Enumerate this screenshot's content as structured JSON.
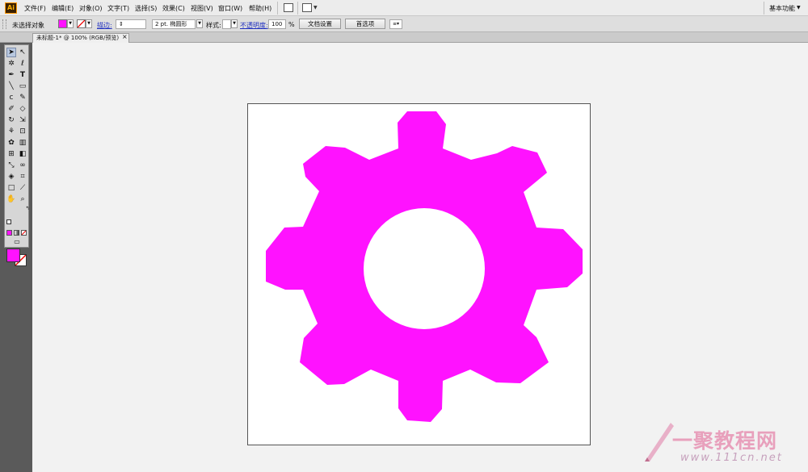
{
  "app": {
    "logo": "Ai",
    "menus": [
      "文件(F)",
      "编辑(E)",
      "对象(O)",
      "文字(T)",
      "选择(S)",
      "效果(C)",
      "视图(V)",
      "窗口(W)",
      "帮助(H)"
    ],
    "workspace_label": "基本功能"
  },
  "control_bar": {
    "selection_status": "未选择对象",
    "fill_color": "#ff12ff",
    "stroke_label": "描边:",
    "stroke_weight": "",
    "brush_value": "2 pt. 椭圆形",
    "style_label": "样式:",
    "opacity_label": "不透明度:",
    "opacity_value": "100",
    "opacity_unit": "%",
    "doc_setup_button": "文档设置",
    "preferences_button": "首选项"
  },
  "document": {
    "tab_title": "未标题-1* @ 100% (RGB/预览)",
    "tab_close": "×"
  },
  "tools": {
    "fill_color": "#ff12ff",
    "stroke_color": "none"
  },
  "artwork": {
    "shape": "gear-icon",
    "color": "#ff12ff",
    "background": "#ffffff"
  },
  "watermark": {
    "main": "一聚教程网",
    "sub": "www.111cn.net"
  }
}
